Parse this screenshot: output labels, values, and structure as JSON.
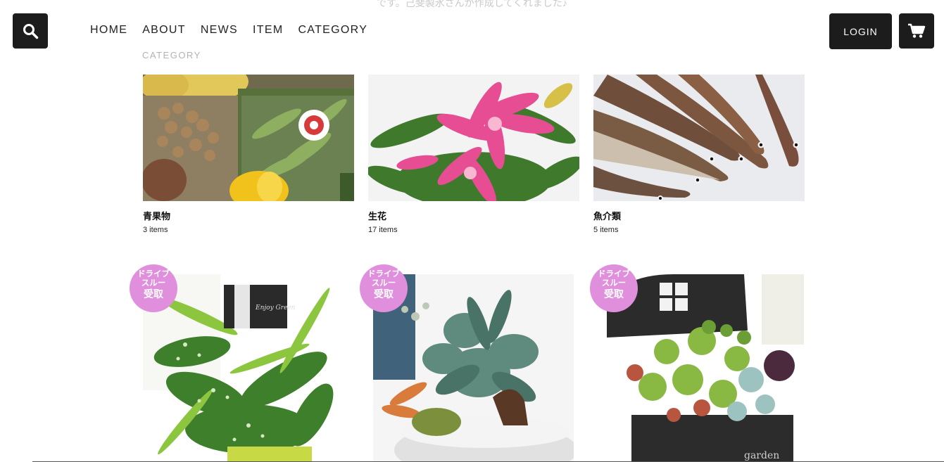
{
  "header": {
    "top_note": "です。己斐製氷さんが作成してくれました♪",
    "nav": [
      "HOME",
      "ABOUT",
      "NEWS",
      "ITEM",
      "CATEGORY"
    ],
    "sub_label": "CATEGORY",
    "login_label": "LOGIN",
    "icons": {
      "search": "search-icon",
      "cart": "cart-icon"
    }
  },
  "categories": [
    {
      "name": "青果物",
      "count": "3 items"
    },
    {
      "name": "生花",
      "count": "17 items"
    },
    {
      "name": "魚介類",
      "count": "5 items"
    }
  ],
  "products": [
    {
      "badge": [
        "ドライブ",
        "スルー",
        "受取"
      ],
      "tag_text": "Enjoy Green"
    },
    {
      "badge": [
        "ドライブ",
        "スルー",
        "受取"
      ]
    },
    {
      "badge": [
        "ドライブ",
        "スルー",
        "受取"
      ],
      "sign_text": "garden"
    }
  ],
  "colors": {
    "button_bg": "#1c1c1c",
    "badge": "#e08fdc",
    "muted": "#b3b3b3"
  }
}
